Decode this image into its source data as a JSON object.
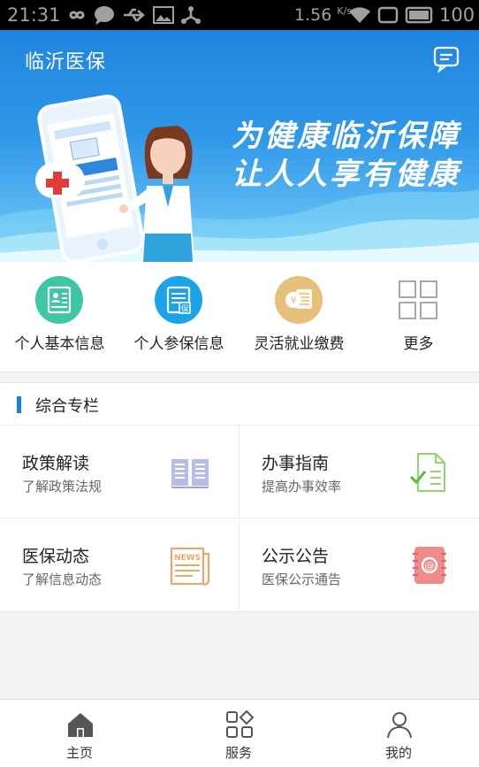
{
  "status_bar": {
    "time": "21:31",
    "speed": "1.56",
    "speed_unit": "K/s",
    "battery": "100",
    "icons": [
      "infinity-icon",
      "chat-icon",
      "usb-icon",
      "image-icon",
      "share-icon",
      "wifi-icon",
      "square-icon",
      "battery-icon"
    ]
  },
  "header": {
    "title": "临沂医保",
    "message_icon": "message-icon"
  },
  "banner": {
    "slogan_line1": "为健康临沂保障",
    "slogan_line2": "让人人享有健康"
  },
  "quick_actions": [
    {
      "label": "个人基本信息",
      "icon": "id-card-icon",
      "color": "#3fc6a5"
    },
    {
      "label": "个人参保信息",
      "icon": "insurance-doc-icon",
      "color": "#1aa3e9"
    },
    {
      "label": "灵活就业缴费",
      "icon": "yuan-coin-icon",
      "color": "#e6c07a"
    },
    {
      "label": "更多",
      "icon": "more-grid-icon",
      "color": "#a8a8a8"
    }
  ],
  "section": {
    "title": "综合专栏",
    "accent": "#1b7fe0",
    "cards": [
      {
        "title": "政策解读",
        "subtitle": "了解政策法规",
        "icon": "book-icon"
      },
      {
        "title": "办事指南",
        "subtitle": "提高办事效率",
        "icon": "checklist-doc-icon"
      },
      {
        "title": "医保动态",
        "subtitle": "了解信息动态",
        "icon": "news-icon"
      },
      {
        "title": "公示公告",
        "subtitle": "医保公示通告",
        "icon": "address-book-icon"
      }
    ]
  },
  "tabbar": {
    "tabs": [
      {
        "label": "主页",
        "icon": "home-icon",
        "active": true
      },
      {
        "label": "服务",
        "icon": "services-grid-icon",
        "active": false
      },
      {
        "label": "我的",
        "icon": "user-icon",
        "active": false
      }
    ]
  }
}
